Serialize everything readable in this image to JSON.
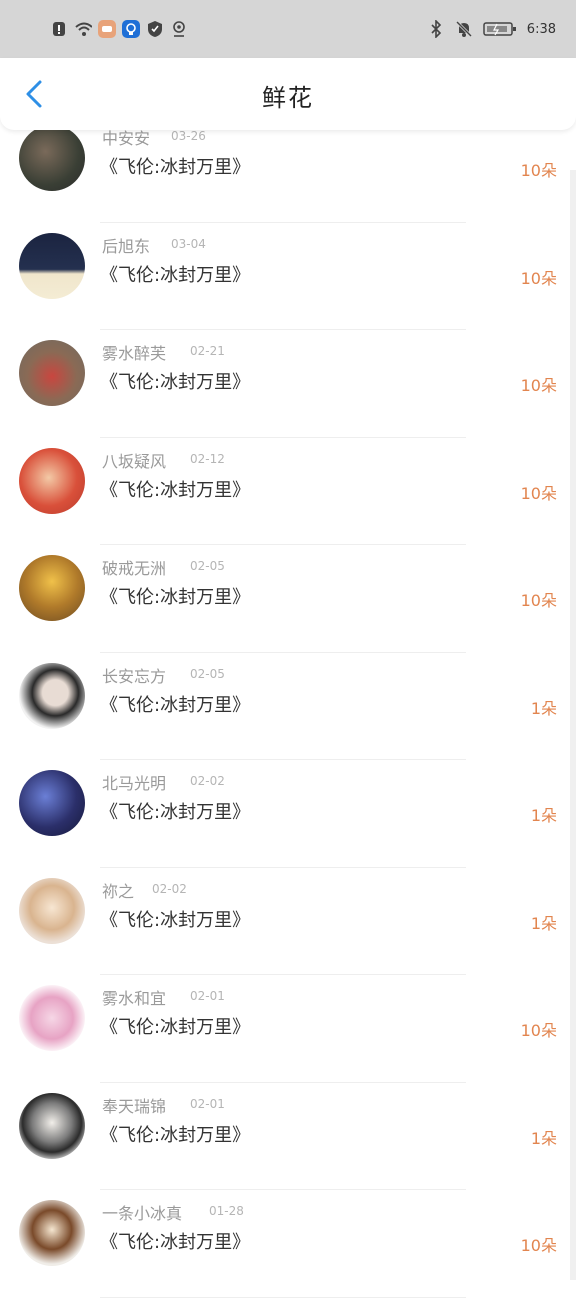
{
  "status_bar": {
    "time": "6:38",
    "left_icons": [
      "alert-icon",
      "wifi-icon",
      "message-icon",
      "bulb-icon",
      "shield-icon",
      "location-icon"
    ],
    "right_icons": [
      "bluetooth-icon",
      "bell-off-icon",
      "battery-icon"
    ]
  },
  "header": {
    "title": "鲜花"
  },
  "rows": [
    {
      "name": "中安安",
      "date": "03-26",
      "book": "《飞伦:冰封万里》",
      "count": "10朵"
    },
    {
      "name": "后旭东",
      "date": "03-04",
      "book": "《飞伦:冰封万里》",
      "count": "10朵"
    },
    {
      "name": "雾水醉芙",
      "date": "02-21",
      "book": "《飞伦:冰封万里》",
      "count": "10朵"
    },
    {
      "name": "八坂疑风",
      "date": "02-12",
      "book": "《飞伦:冰封万里》",
      "count": "10朵"
    },
    {
      "name": "破戒无洲",
      "date": "02-05",
      "book": "《飞伦:冰封万里》",
      "count": "10朵"
    },
    {
      "name": "长安忘方",
      "date": "02-05",
      "book": "《飞伦:冰封万里》",
      "count": "1朵"
    },
    {
      "name": "北马光明",
      "date": "02-02",
      "book": "《飞伦:冰封万里》",
      "count": "1朵"
    },
    {
      "name": "祢之",
      "date": "02-02",
      "book": "《飞伦:冰封万里》",
      "count": "1朵"
    },
    {
      "name": "雾水和宜",
      "date": "02-01",
      "book": "《飞伦:冰封万里》",
      "count": "10朵"
    },
    {
      "name": "奉天瑞锦",
      "date": "02-01",
      "book": "《飞伦:冰封万里》",
      "count": "1朵"
    },
    {
      "name": "一条小冰真",
      "date": "01-28",
      "book": "《飞伦:冰封万里》",
      "count": "10朵"
    }
  ],
  "colors": {
    "accent": "#2e8fe6",
    "count": "#e2854f"
  }
}
